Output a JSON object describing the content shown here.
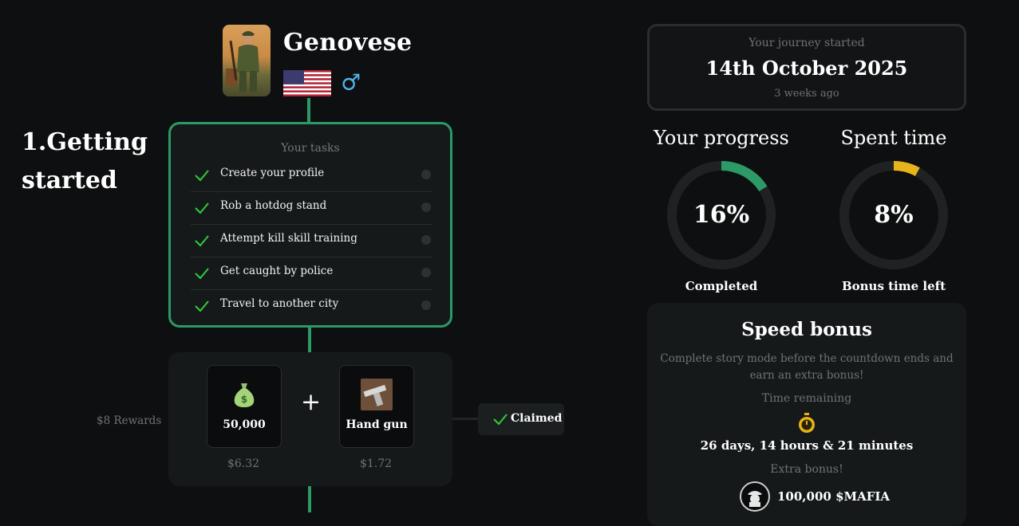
{
  "profile": {
    "name": "Genovese",
    "gender_symbol": "♂",
    "flag_icon": "us-flag-icon",
    "avatar_icon": "soldier-avatar"
  },
  "chapter": {
    "title": "1.Getting started"
  },
  "tasks": {
    "title": "Your tasks",
    "items": [
      {
        "label": "Create your profile",
        "done": true
      },
      {
        "label": "Rob a hotdog stand",
        "done": true
      },
      {
        "label": "Attempt kill skill training",
        "done": true
      },
      {
        "label": "Get caught by police",
        "done": true
      },
      {
        "label": "Travel to another city",
        "done": true
      }
    ]
  },
  "rewards": {
    "label": "$8 Rewards",
    "plus": "+",
    "items": [
      {
        "name": "50,000",
        "price": "$6.32",
        "icon": "money-bag-icon"
      },
      {
        "name": "Hand gun",
        "price": "$1.72",
        "icon": "handgun-icon"
      }
    ],
    "claimed_label": "Claimed"
  },
  "journey": {
    "label": "Your journey started",
    "date": "14th October 2025",
    "ago": "3 weeks ago"
  },
  "progress": {
    "title": "Your progress",
    "value_text": "16%",
    "value": 16,
    "caption": "Completed",
    "color": "#2b9a66"
  },
  "spent_time": {
    "title": "Spent time",
    "value_text": "8%",
    "value": 8,
    "caption": "Bonus time left",
    "color": "#e8b21a"
  },
  "speed_bonus": {
    "title": "Speed bonus",
    "description": "Complete story mode before the countdown ends and earn an extra bonus!",
    "remaining_label": "Time remaining",
    "countdown": "26 days, 14 hours & 21 minutes",
    "extra_label": "Extra bonus!",
    "extra_amount": "100,000 $MAFIA",
    "icon": "stopwatch-icon"
  },
  "colors": {
    "accent_green": "#2b9a66",
    "check_green": "#2ecc40",
    "accent_yellow": "#e8b21a",
    "background": "#0e0f10",
    "card": "#16191a"
  }
}
